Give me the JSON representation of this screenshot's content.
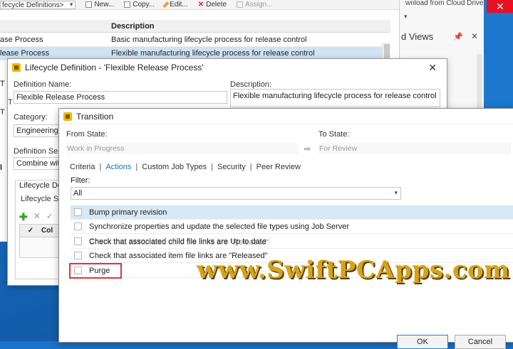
{
  "main_window": {
    "toolbar": {
      "definitions_dropdown": "fecycle Definitions>",
      "new_label": "New...",
      "copy_label": "Copy...",
      "edit_label": "Edit...",
      "delete_label": "Delete",
      "assign_label": "Assign..."
    },
    "grid": {
      "headers": [
        "",
        "Description"
      ],
      "rows": [
        {
          "name": "ase Process",
          "description": "Basic manufacturing lifecycle process for release control"
        },
        {
          "name": "lease Process",
          "description": "Flexible manufacturing lifecycle process for release control"
        }
      ]
    }
  },
  "right_panel": {
    "top_text": "wnload from Cloud Drive",
    "panel_title": "d Views",
    "pin_icon": "pin-icon",
    "close_icon": "close-icon"
  },
  "lifecycle_dialog": {
    "title": "Lifecycle Definition - 'Flexible Release Process'",
    "definition_name_label": "Definition Name:",
    "definition_name_value": "Flexible Release Process",
    "description_label": "Description:",
    "description_value": "Flexible manufacturing lifecycle process for release control",
    "category_label": "Category:",
    "category_value": "Engineering",
    "security_label": "Definition Secu",
    "security_value": "Combine with",
    "lifecycle_group_title": "Lifecycle Defi",
    "lifecycle_states_label": "Lifecycle Sta",
    "grid_col": "Col",
    "left_cut_labels": [
      "T",
      "T",
      "T",
      "l"
    ]
  },
  "transition_dialog": {
    "title": "Transition",
    "from_state_label": "From State:",
    "from_state_value": "Work in Progress",
    "to_state_label": "To State:",
    "to_state_value": "For Review",
    "tabs": [
      {
        "label": "Criteria",
        "active": false
      },
      {
        "label": "Actions",
        "active": true
      },
      {
        "label": "Custom Job Types",
        "active": false
      },
      {
        "label": "Security",
        "active": false
      },
      {
        "label": "Peer Review",
        "active": false
      }
    ],
    "filter_label": "Filter:",
    "filter_value": "All",
    "actions": [
      {
        "label": "Bump primary revision",
        "selected": true
      },
      {
        "label": "Synchronize properties and update the selected file types using Job Server",
        "selected": false
      },
      {
        "label": "Check that associated child file links are Up to date",
        "selected": false
      },
      {
        "label": "Check that associated item file links are \"Released\"",
        "selected": false
      },
      {
        "label": "Purge",
        "selected": false
      }
    ],
    "ghost_overlay_text": "Check that associated child file links are \"Released\"",
    "ok_label": "OK",
    "cancel_label": "Cancel"
  },
  "watermark": "www.SwiftPCApps.com",
  "colors": {
    "accent": "#1f6fbf",
    "highlight_red": "#d9363e",
    "selection": "#d7e8f6",
    "watermark": "#d7a21a"
  }
}
